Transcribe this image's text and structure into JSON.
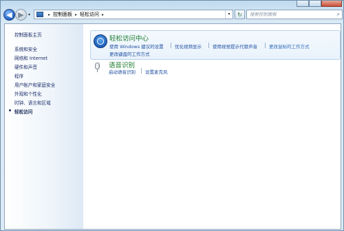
{
  "window": {
    "controls": {
      "minimize": "",
      "maximize": "",
      "close": ""
    }
  },
  "toolbar": {
    "back_glyph": "◀",
    "forward_glyph": "▶",
    "nav_dropdown_glyph": "▾",
    "breadcrumb": [
      "控制面板",
      "轻松访问"
    ],
    "breadcrumb_sep": "▸",
    "address_dropdown_glyph": "▾",
    "refresh_glyph": "↻",
    "search_placeholder": "搜索控制面板",
    "search_icon": "⌕"
  },
  "sidebar": {
    "home": "控制面板主页",
    "items": [
      "系统和安全",
      "网络和 Internet",
      "硬件和声音",
      "程序",
      "用户帐户和家庭安全",
      "外观和个性化",
      "时钟、语言和区域",
      "轻松访问"
    ],
    "current_index": 7
  },
  "content": {
    "ease_center": {
      "icon": "ease-of-access-icon",
      "title": "轻松访问中心",
      "links": [
        "使用 Windows 建议的设置",
        "优化视频显示",
        "使用视觉提示代替声音",
        "更改鼠标的工作方式"
      ],
      "link2": "更改键盘的工作方式"
    },
    "speech": {
      "icon": "microphone-icon",
      "title": "语音识别",
      "links": [
        "启动语音识别",
        "设置麦克风"
      ]
    }
  },
  "colors": {
    "title_green": "#1a7a2c",
    "link_blue": "#1e4fa0",
    "sidebar_text": "#1c2f6b"
  }
}
